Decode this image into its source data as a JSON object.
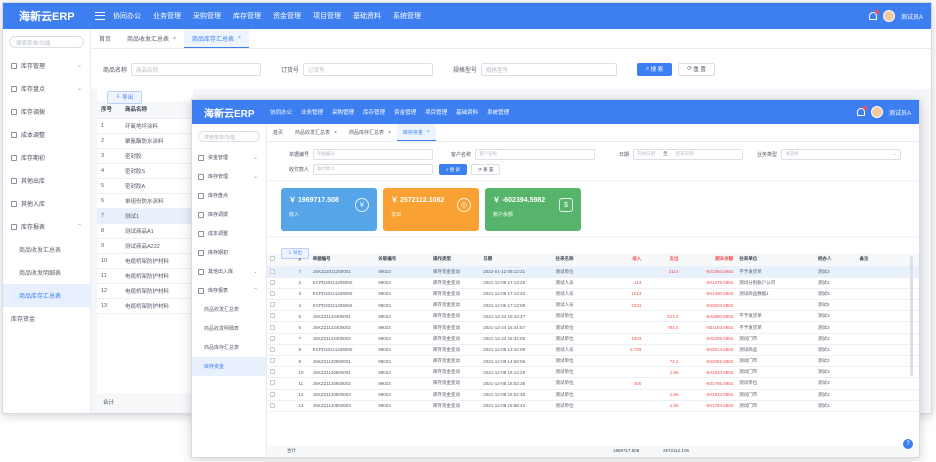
{
  "colors": {
    "primary": "#3d7ef0",
    "income_card": "#55a5e8",
    "expense_card": "#f9a233",
    "balance_card": "#56b56b",
    "negative": "#f25050"
  },
  "win1": {
    "logo": "海新云ERP",
    "topnav": [
      "协同办公",
      "业务管理",
      "采购管理",
      "库存管理",
      "资金管理",
      "项目管理",
      "基础资料",
      "系统管理"
    ],
    "user": "测试员A",
    "search_placeholder": "搜索菜单/功能",
    "sidebar": [
      {
        "label": "库存管理",
        "sub": false
      },
      {
        "label": "库存盘点",
        "sub": false
      },
      {
        "label": "库存调拨",
        "sub": false
      },
      {
        "label": "成本调整",
        "sub": false
      },
      {
        "label": "库存期初",
        "sub": false
      },
      {
        "label": "其他出库",
        "sub": false
      },
      {
        "label": "其他入库",
        "sub": false
      },
      {
        "label": "库存报表",
        "sub": false
      },
      {
        "label": "商品收发汇总表",
        "sub": true
      },
      {
        "label": "商品收发明细表",
        "sub": true
      },
      {
        "label": "商品库存汇总表",
        "sub": true
      },
      {
        "label": "库存资金",
        "sub": false
      }
    ],
    "tabs": [
      "首页",
      "商品收发汇总表",
      "商品库存汇总表"
    ],
    "filters": {
      "name_label": "商品名称",
      "name_placeholder": "商品名称",
      "code_label": "订货号",
      "code_placeholder": "订货号",
      "spec_label": "规格型号",
      "spec_placeholder": "规格型号",
      "search_btn": "搜 索",
      "reset_btn": "重 置"
    },
    "export_btn": "导出",
    "table": {
      "headers": [
        "序号",
        "商品名称"
      ],
      "rows": [
        [
          "1",
          "环氧地坪涂料"
        ],
        [
          "2",
          "聚氨酯防水涂料"
        ],
        [
          "3",
          "密封胶"
        ],
        [
          "4",
          "密封胶S"
        ],
        [
          "5",
          "密封胶A"
        ],
        [
          "6",
          "单组份防水涂料"
        ],
        [
          "7",
          "测试1"
        ],
        [
          "8",
          "测试商品A1"
        ],
        [
          "9",
          "测试商品A222"
        ],
        [
          "10",
          "电缆桥架防护材料"
        ],
        [
          "11",
          "电缆桥架防护材料"
        ],
        [
          "12",
          "电缆桥架防护材料"
        ],
        [
          "13",
          "电缆桥架防护材料"
        ]
      ],
      "footer": "合计"
    }
  },
  "win2": {
    "logo": "海新云ERP",
    "topnav": [
      "协同办公",
      "业务管理",
      "采购管理",
      "库存管理",
      "资金管理",
      "项目管理",
      "基础资料",
      "系统管理"
    ],
    "user": "测试员A",
    "search_placeholder": "搜索菜单/功能",
    "sidebar": [
      {
        "label": "资金管理",
        "sub": false
      },
      {
        "label": "库存管理",
        "sub": false
      },
      {
        "label": "库存盘点",
        "sub": false
      },
      {
        "label": "库存调拨",
        "sub": false
      },
      {
        "label": "成本调整",
        "sub": false
      },
      {
        "label": "库存期初",
        "sub": false
      },
      {
        "label": "其他出入库",
        "sub": false
      },
      {
        "label": "库存报表",
        "sub": false
      },
      {
        "label": "商品收发汇总表",
        "sub": true
      },
      {
        "label": "商品收发明细表",
        "sub": true
      },
      {
        "label": "商品库存汇总表",
        "sub": true
      },
      {
        "label": "库存资金",
        "sub": true
      }
    ],
    "tabs": [
      "首页",
      "商品收发汇总表",
      "商品库存汇总表",
      "库存资金"
    ],
    "filters": {
      "order_label": "单据编号",
      "order_placeholder": "单据编号",
      "client_label": "客户名称",
      "client_placeholder": "客户名称",
      "date_label": "日期",
      "date_start": "开始日期",
      "date_sep": "至",
      "date_end": "结束日期",
      "type_label": "业务类型",
      "type_placeholder": "请选择",
      "account_label": "收付款人",
      "account_placeholder": "收付款人",
      "search_btn": "搜 索",
      "reset_btn": "重 置"
    },
    "cards": [
      {
        "value": "￥ 1969717.508",
        "label": "收入",
        "icon": "¥"
      },
      {
        "value": "￥ 2572112.1062",
        "label": "支出",
        "icon": "◎"
      },
      {
        "value": "￥ -602394.5982",
        "label": "账户余额",
        "icon": "$"
      }
    ],
    "export_btn": "导出",
    "table": {
      "headers": [
        "",
        "#",
        "单据编号",
        "关联编号",
        "操作类型",
        "日期",
        "往来名称",
        "收入",
        "支出",
        "期末余额",
        "往来单位",
        "经办人",
        "备注"
      ],
      "rows": [
        [
          "7",
          "JSKZ22011200001",
          "99023",
          "库存资金变动",
          "2022-01-12 09:13:31",
          "测试单位",
          "",
          "3114",
          "-602394.5982",
          "不予发货单",
          "测试3"
        ],
        [
          "2",
          "KCPD20211206000",
          "99023",
          "库存资金变动",
          "2021-12-06 17:13:26",
          "测试人员",
          "113",
          "",
          "-601379.5982",
          "测试分别账户公司",
          "测试4"
        ],
        [
          "3",
          "KCPD20211208000",
          "99023",
          "库存资金变动",
          "2021-12-08 17:13:20",
          "测试人员",
          "1013",
          "",
          "-601490.5982",
          "测试商品数据1",
          "测试5"
        ],
        [
          "4",
          "KCPD20211206004",
          "99023",
          "库存资金变动",
          "2021-12-06 17:13:08",
          "测试人员",
          "2231",
          "",
          "-602503.5982",
          "",
          "测试5"
        ],
        [
          "5",
          "JSKZ21122400001",
          "99023",
          "库存资金变动",
          "2021-12-24 15:43:37",
          "测试单位",
          "",
          "513.4",
          "-602680.5982",
          "不予发货单",
          "测试3"
        ],
        [
          "6",
          "JSKZ21122400002",
          "99023",
          "库存资金变动",
          "2021-12-24 15:41:57",
          "测试单位",
          "",
          "784.4",
          "-601193.5982",
          "不予发货单",
          "测试3"
        ],
        [
          "7",
          "JSKZ21122400002",
          "99023",
          "库存资金变动",
          "2021-12-24 15:34:05",
          "测试单位",
          "1603",
          "",
          "-602409.5982",
          "测试门市",
          "测试3"
        ],
        [
          "8",
          "KCPD20211206000",
          "99023",
          "库存资金变动",
          "2021-12-06 13:42:09",
          "测试人员",
          "5.728",
          "",
          "-602013.5982",
          "测试商品",
          "测试3"
        ],
        [
          "9",
          "JSKZ21120900001",
          "99023",
          "库存资金变动",
          "2021-12-09 14:58:06",
          "测试单位",
          "",
          "72.2",
          "-602086.5982",
          "测试门市",
          "测试3"
        ],
        [
          "10",
          "JSKZ21120800001",
          "99023",
          "库存资金变动",
          "2021-12-08 16:14:25",
          "测试单位",
          "",
          "1.66",
          "-601933.5982",
          "测试门市",
          "测试3"
        ],
        [
          "11",
          "JSKZ21120800002",
          "99023",
          "库存资金变动",
          "2021-12-08 16:02:36",
          "测试单位",
          "400",
          "",
          "-601786.5982",
          "测试单位",
          "测试3"
        ],
        [
          "12",
          "JSKZ21120800003",
          "99023",
          "库存资金变动",
          "2021-12-08 16:02:36",
          "测试单位",
          "",
          "1.66",
          "-601933.5982",
          "测试门市",
          "测试3"
        ],
        [
          "13",
          "JSKZ21120800004",
          "99023",
          "库存资金变动",
          "2021-12-08 15:58:42",
          "测试单位",
          "",
          "1.66",
          "-601784.5982",
          "测试门市",
          "测试3"
        ]
      ],
      "footer": {
        "label": "合计",
        "income": "1969717.508",
        "expense": "2572112.106"
      }
    }
  }
}
